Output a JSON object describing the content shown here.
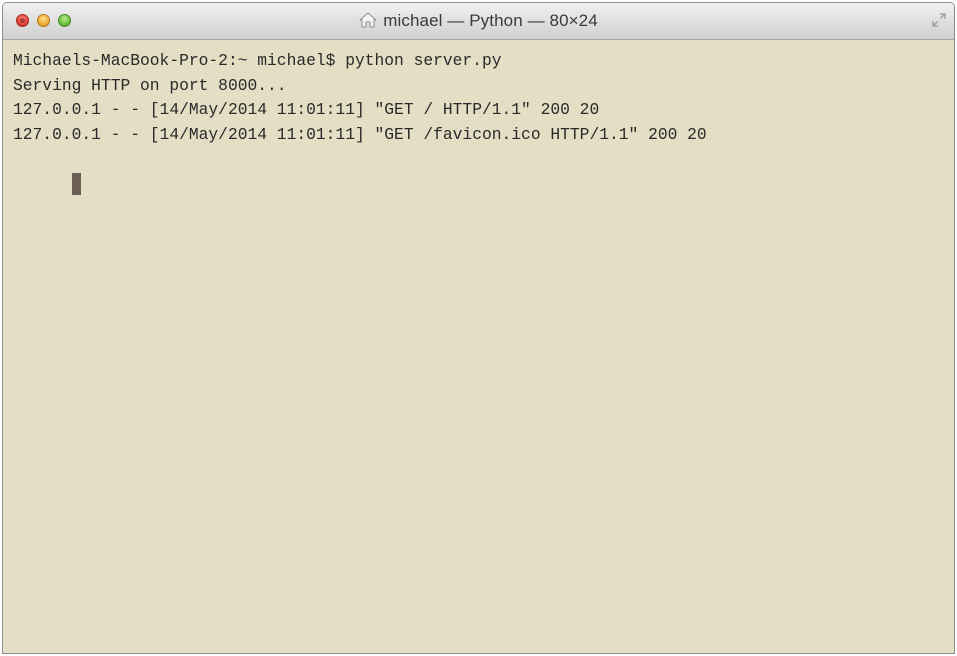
{
  "window": {
    "title": "michael — Python — 80×24",
    "title_icon": "home-icon",
    "controls": [
      "close-button",
      "minimize-button",
      "zoom-button"
    ],
    "fullscreen_icon": "fullscreen-arrows-icon"
  },
  "terminal": {
    "lines": [
      "Michaels-MacBook-Pro-2:~ michael$ python server.py",
      "Serving HTTP on port 8000...",
      "127.0.0.1 - - [14/May/2014 11:01:11] \"GET / HTTP/1.1\" 200 20",
      "127.0.0.1 - - [14/May/2014 11:01:11] \"GET /favicon.ico HTTP/1.1\" 200 20"
    ],
    "background_color": "#e4dec5",
    "text_color": "#2a2a2a",
    "cursor_color": "#6b5e54"
  }
}
